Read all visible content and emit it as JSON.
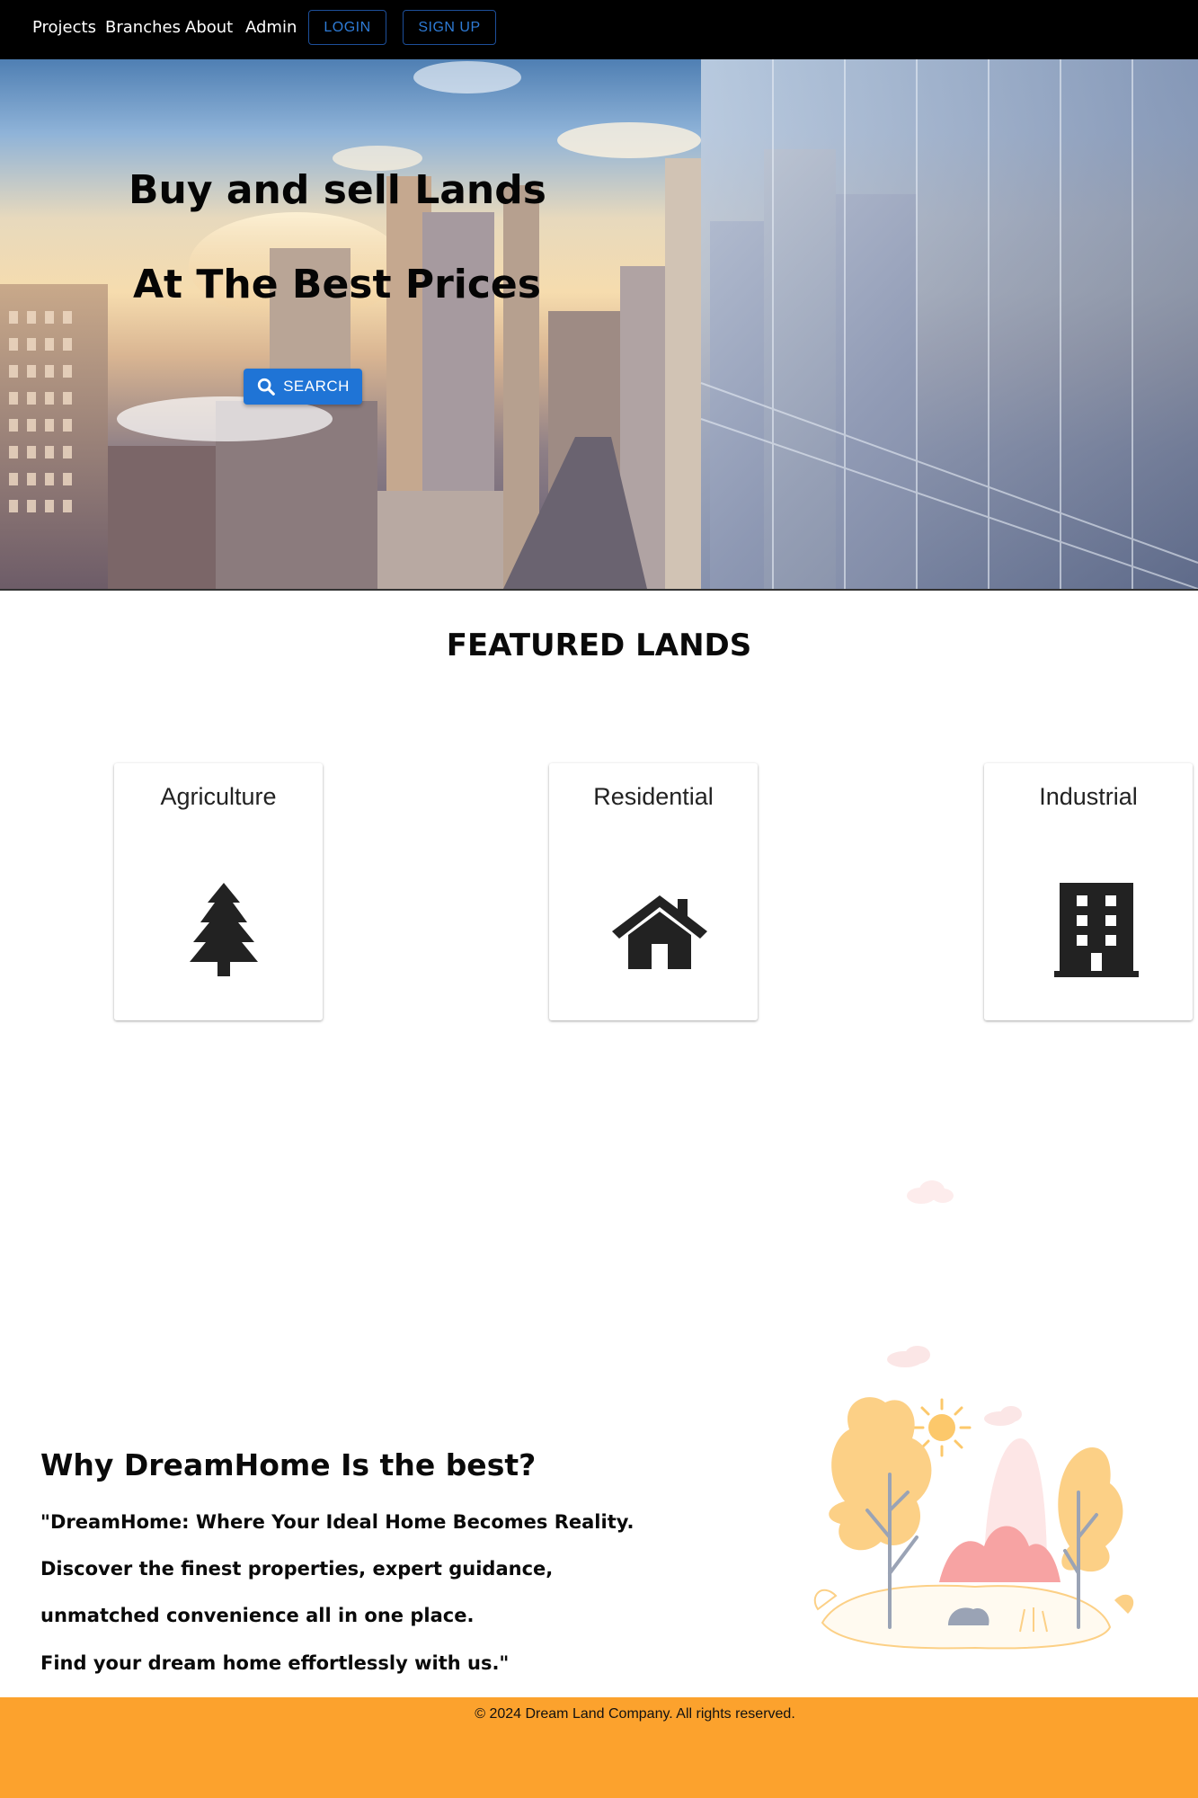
{
  "nav": {
    "links": [
      "Projects",
      "Branches",
      "About",
      "Admin"
    ],
    "login_label": "LOGIN",
    "signup_label": "SIGN UP"
  },
  "hero": {
    "line1": "Buy and sell Lands",
    "line2": "At The Best Prices",
    "search_label": "SEARCH"
  },
  "featured": {
    "title": "FEATURED LANDS",
    "cards": [
      {
        "title": "Agriculture",
        "icon": "tree-icon"
      },
      {
        "title": "Residential",
        "icon": "house-icon"
      },
      {
        "title": "Industrial",
        "icon": "building-icon"
      }
    ]
  },
  "why": {
    "title": "Why DreamHome Is the best?",
    "lines": [
      "\"DreamHome: Where Your Ideal Home Becomes Reality.",
      "Discover the finest properties, expert guidance,",
      "unmatched convenience all in one place.",
      "Find your dream home effortlessly with us.\""
    ]
  },
  "footer": {
    "text": "© 2024 Dream Land Company. All rights reserved."
  },
  "colors": {
    "navbar": "#000000",
    "accent_blue": "#1f74d6",
    "footer": "#fca22d",
    "illustration_orange": "#fcd086",
    "illustration_pink": "#f7a3a3"
  }
}
